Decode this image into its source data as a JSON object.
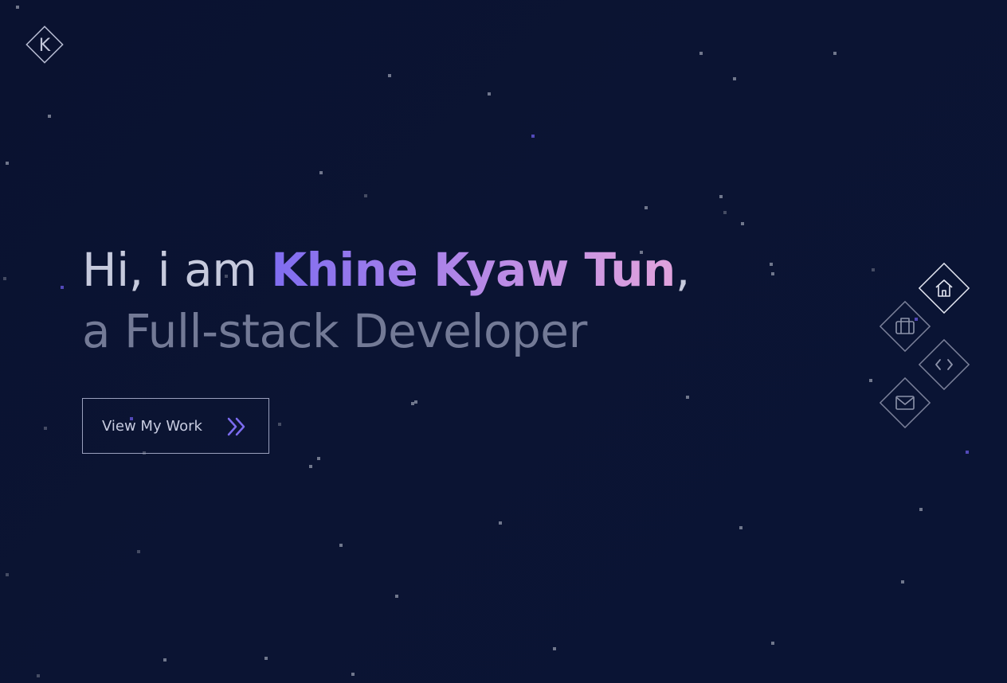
{
  "logo": {
    "letter": "K"
  },
  "hero": {
    "greeting": "Hi, i am ",
    "name": "Khine Kyaw Tun",
    "comma": ",",
    "subtitle": "a Full-stack Developer"
  },
  "cta": {
    "label": "View My Work",
    "icon": "double-chevron-right-icon"
  },
  "side_nav": [
    {
      "id": "home",
      "icon": "home-icon",
      "active": true
    },
    {
      "id": "work",
      "icon": "briefcase-icon",
      "active": false
    },
    {
      "id": "code",
      "icon": "code-icon",
      "active": false
    },
    {
      "id": "contact",
      "icon": "mail-icon",
      "active": false
    }
  ],
  "colors": {
    "background": "#0a1230",
    "name_gradient_start": "#7f6df0",
    "name_gradient_end": "#e0a3dd",
    "subtitle": "#737a96",
    "accent": "#6c5ce7"
  }
}
